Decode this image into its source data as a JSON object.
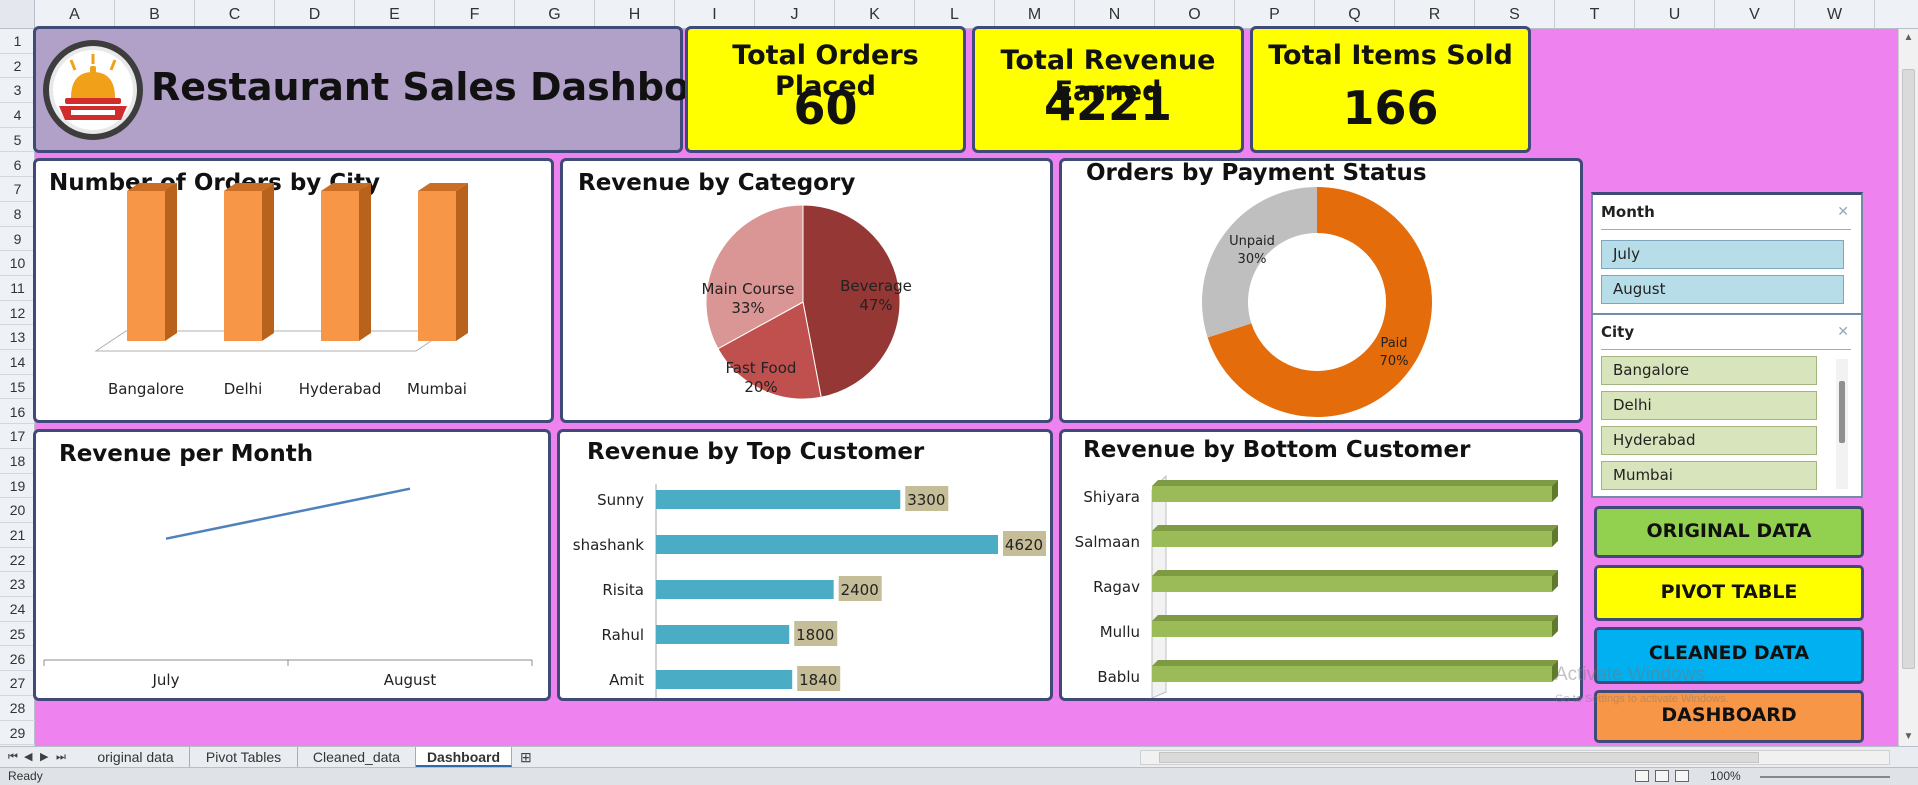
{
  "columns": [
    "A",
    "B",
    "C",
    "D",
    "E",
    "F",
    "G",
    "H",
    "I",
    "J",
    "K",
    "L",
    "M",
    "N",
    "O",
    "P",
    "Q",
    "R",
    "S",
    "T",
    "U",
    "V",
    "W"
  ],
  "rows": [
    "1",
    "2",
    "3",
    "4",
    "5",
    "6",
    "7",
    "8",
    "9",
    "10",
    "11",
    "12",
    "13",
    "14",
    "15",
    "16",
    "17",
    "18",
    "19",
    "20",
    "21",
    "22",
    "23",
    "24",
    "25",
    "26",
    "27",
    "28",
    "29"
  ],
  "colors": {
    "canvas": "#ee82ee",
    "title_panel": "#b1a1c8",
    "kpi": "#ffff00",
    "panel_border": "#3f4a78",
    "bar_orange": "#f79646",
    "bar_teal": "#4bacc6",
    "bar_green": "#9bbb59",
    "line_blue": "#4f81bd",
    "donut_paid": "#e46c0a",
    "donut_unpaid": "#bfbfbf",
    "pie_beverage": "#953735",
    "pie_fastfood": "#c0504d",
    "pie_maincourse": "#d99694",
    "data_label_bg": "#c4bd97"
  },
  "dashboard": {
    "title": "Restaurant Sales Dashboard",
    "logo_icon": "restaurant-cloche-logo-icon"
  },
  "kpis": [
    {
      "label": "Total Orders Placed",
      "value": "60"
    },
    {
      "label": "Total Revenue Earned",
      "value": "4221"
    },
    {
      "label": "Total Items Sold",
      "value": "166"
    }
  ],
  "chart_data": [
    {
      "id": "orders_by_city",
      "type": "bar",
      "title": "Number of Orders by City",
      "categories": [
        "Bangalore",
        "Delhi",
        "Hyderabad",
        "Mumbai"
      ],
      "values": [
        15,
        15,
        15,
        15
      ],
      "style": "3d-column"
    },
    {
      "id": "revenue_by_category",
      "type": "pie",
      "title": "Revenue by Category",
      "labels": [
        "Beverage",
        "Fast Food",
        "Main Course"
      ],
      "values": [
        47,
        20,
        33
      ],
      "value_labels": [
        "47%",
        "20%",
        "33%"
      ]
    },
    {
      "id": "orders_by_payment_status",
      "type": "pie",
      "style": "donut",
      "title": "Orders by Payment Status",
      "labels": [
        "Paid",
        "Unpaid"
      ],
      "values": [
        70,
        30
      ],
      "value_labels": [
        "70%",
        "30%"
      ]
    },
    {
      "id": "revenue_per_month",
      "type": "line",
      "title": "Revenue per Month",
      "categories": [
        "July",
        "August"
      ],
      "values": [
        1750,
        2471
      ]
    },
    {
      "id": "revenue_by_top_customer",
      "type": "bar",
      "orientation": "horizontal",
      "title": "Revenue by Top Customer",
      "categories": [
        "Sunny",
        "shashank",
        "Risita",
        "Rahul",
        "Amit"
      ],
      "values": [
        3300,
        4620,
        2400,
        1800,
        1840
      ],
      "value_labels": [
        "3300",
        "4620",
        "2400",
        "1800",
        "1840"
      ]
    },
    {
      "id": "revenue_by_bottom_customer",
      "type": "bar",
      "orientation": "horizontal",
      "style": "3d-bar",
      "title": "Revenue by Bottom Customer",
      "categories": [
        "Shiyara",
        "Salmaan",
        "Ragav",
        "Mullu",
        "Bablu"
      ],
      "values": [
        100,
        100,
        100,
        100,
        100
      ]
    }
  ],
  "slicers": {
    "month": {
      "title": "Month",
      "items": [
        "July",
        "August"
      ],
      "clear_icon": "clear-filter-icon"
    },
    "city": {
      "title": "City",
      "items": [
        "Bangalore",
        "Delhi",
        "Hyderabad",
        "Mumbai"
      ],
      "clear_icon": "clear-filter-icon"
    }
  },
  "nav_buttons": [
    {
      "label": "ORIGINAL DATA",
      "color": "#92d050"
    },
    {
      "label": "PIVOT TABLE",
      "color": "#ffff00"
    },
    {
      "label": "CLEANED DATA",
      "color": "#00b0f0"
    },
    {
      "label": "DASHBOARD",
      "color": "#f79646"
    }
  ],
  "sheet_tabs": [
    "original data",
    "Pivot Tables",
    "Cleaned_data",
    "Dashboard"
  ],
  "active_tab": "Dashboard",
  "status": {
    "ready": "Ready",
    "zoom": "100%"
  },
  "watermark": {
    "line1": "Activate Windows",
    "line2": "Go to Settings to activate Windows."
  }
}
